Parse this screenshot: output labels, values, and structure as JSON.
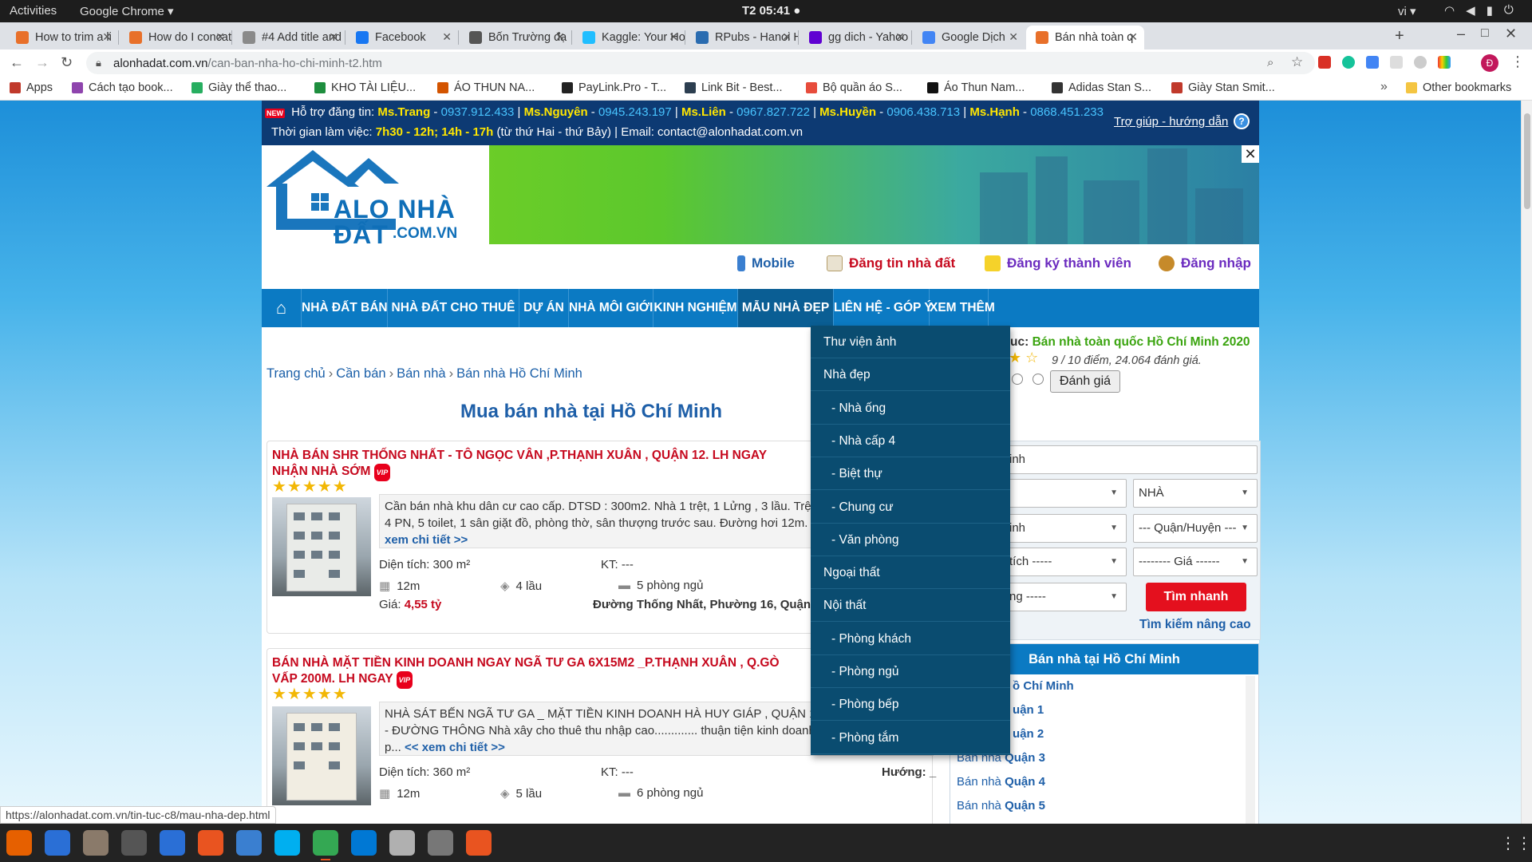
{
  "gnome": {
    "activities": "Activities",
    "app": "Google Chrome ▾",
    "clock": "T2 05:41 ●",
    "lang": "vi ▾",
    "tray": [
      "wifi-icon",
      "volume-icon",
      "battery-icon",
      "power-icon"
    ]
  },
  "tabs": [
    {
      "title": "How to trim a li",
      "icon_color": "#e8702a"
    },
    {
      "title": "How do I concat",
      "icon_color": "#e8702a"
    },
    {
      "title": "#4 Add title and",
      "icon_color": "#8a8a8a"
    },
    {
      "title": "Facebook",
      "icon_color": "#1877f2"
    },
    {
      "title": "Bốn Trường đạ",
      "icon_color": "#555555"
    },
    {
      "title": "Kaggle: Your Ho",
      "icon_color": "#20beff"
    },
    {
      "title": "RPubs - Hanoi H",
      "icon_color": "#2a6cb0"
    },
    {
      "title": "gg dich - Yahoo",
      "icon_color": "#6001d2"
    },
    {
      "title": "Google Dịch",
      "icon_color": "#4285f4"
    },
    {
      "title": "Bán nhà toàn q",
      "icon_color": "#e8702a",
      "active": true
    }
  ],
  "address": {
    "domain": "alonhadat.com.vn",
    "path": "/can-ban-nha-ho-chi-minh-t2.htm"
  },
  "bookmarks": [
    {
      "label": "Apps",
      "color": "#c0392b"
    },
    {
      "label": "Cách tạo book...",
      "color": "#8e44ad"
    },
    {
      "label": "Giày thể thao...",
      "color": "#27ae60"
    },
    {
      "label": "KHO TÀI LIỆU...",
      "color": "#1e8e3e"
    },
    {
      "label": "ÁO THUN NA...",
      "color": "#d35400"
    },
    {
      "label": "PayLink.Pro - T...",
      "color": "#222222"
    },
    {
      "label": "Link Bit - Best...",
      "color": "#2c3e50"
    },
    {
      "label": "Bộ quần áo S...",
      "color": "#e74c3c"
    },
    {
      "label": "Áo Thun Nam...",
      "color": "#111111"
    },
    {
      "label": "Adidas Stan S...",
      "color": "#333333"
    },
    {
      "label": "Giày Stan Smit...",
      "color": "#c0392b"
    }
  ],
  "bookmarks_more": "»",
  "other_bookmarks": "Other bookmarks",
  "site": {
    "new_badge": "NEW",
    "support_label": "Hỗ trợ đăng tin:",
    "contacts": [
      {
        "name": "Ms.Trang",
        "phone": "0937.912.433"
      },
      {
        "name": "Ms.Nguyên",
        "phone": "0945.243.197"
      },
      {
        "name": "Ms.Liên",
        "phone": "0967.827.722"
      },
      {
        "name": "Ms.Huyền",
        "phone": "0906.438.713"
      },
      {
        "name": "Ms.Hạnh",
        "phone": "0868.451.233"
      }
    ],
    "hours_label": "Thời gian làm việc:",
    "hours": "7h30 - 12h; 14h - 17h",
    "hours_note": "(từ thứ Hai - thứ Bảy) | Email: contact@alonhadat.com.vn",
    "help": "Trợ giúp - hướng dẫn",
    "logo_main": "ALO NHÀ ĐẤT",
    "logo_sub": ".COM.VN",
    "top_links": {
      "mobile": "Mobile",
      "post": "Đăng tin nhà đất",
      "register": "Đăng ký thành viên",
      "login": "Đăng nhập"
    },
    "nav": [
      "NHÀ ĐẤT BÁN",
      "NHÀ ĐẤT CHO THUÊ",
      "DỰ ÁN",
      "NHÀ MÔI GIỚI",
      "KINH NGHIỆM",
      "MẪU NHÀ ĐẸP",
      "LIÊN HỆ - GÓP Ý",
      "XEM THÊM"
    ],
    "breadcrumb": [
      "Trang chủ",
      "Cần bán",
      "Bán nhà",
      "Bán nhà Hồ Chí Minh"
    ],
    "page_title": "Mua bán nhà tại Hồ Chí Minh",
    "rating": {
      "label": "uc:",
      "topic": "Bán nhà toàn quốc Hồ Chí Minh 2020",
      "score": "9 / 10 điểm, 24.064 đánh giá.",
      "button": "Đánh giá"
    },
    "search": {
      "keyword": "inh",
      "type": "NHÀ",
      "city": "inh",
      "district": "--- Quận/Huyện ---",
      "area": "tích -----",
      "price": "-------- Giá ------",
      "direction": "ng -----",
      "quick": "Tìm nhanh",
      "advanced": "Tìm kiếm nâng cao"
    },
    "list": {
      "title": "Bán nhà tại Hồ Chí Minh",
      "items": [
        {
          "prefix": "",
          "name": "ồ Chí Minh"
        },
        {
          "prefix": "",
          "name": "uận 1"
        },
        {
          "prefix": "",
          "name": "uận 2"
        },
        {
          "prefix": "Bán nhà ",
          "name": "Quận 3"
        },
        {
          "prefix": "Bán nhà ",
          "name": "Quận 4"
        },
        {
          "prefix": "Bán nhà ",
          "name": "Quận 5"
        }
      ]
    },
    "listings": [
      {
        "title": "NHÀ BÁN SHR THỐNG NHẤT - TÔ NGỌC VÂN ,P.THẠNH XUÂN , QUẬN 12. LH NGAY NHẬN NHÀ SỚM",
        "vip": "VIP",
        "stars": "★★★★★",
        "desc": "Cần bán nhà khu dân cư cao cấp. DTSD : 300m2. Nhà 1 trệt, 1 Lửng , 3 lầu. Trệt 1 PK, 1 phòng bếp, 4 PN, 5 toilet, 1 sân giặt đồ, phòng thờ, sân thượng trước sau. Đường hơi 12m. Vị trí: Thống nh...",
        "more": "<< xem chi tiết >>",
        "area": "Diện tích: 300 m²",
        "kt": "KT: ---",
        "road": "12m",
        "floors": "4 lầu",
        "rooms": "5 phòng ngủ",
        "price_label": "Giá:",
        "price": "4,55 tỷ",
        "address": "Đường Thống Nhất, Phường 16, Quận"
      },
      {
        "title": "BÁN NHÀ MẶT TIỀN KINH DOANH NGAY NGÃ TƯ GA 6X15M2 _P.THẠNH XUÂN , Q.GÒ VẤP 200M. LH NGAY",
        "vip": "VIP",
        "stars": "★★★★★",
        "desc": "NHÀ SÁT BẾN NGÃ TƯ GA _ MẶT TIỀN KINH DOANH HÀ HUY GIÁP , QUẬN 12. SHR. Đường 12m - ĐƯỜNG THÔNG Nhà xây cho thuê thu nhập cao............. thuận tiện kinh doanh buôn bán, mở văn p...",
        "more": "<< xem chi tiết >>",
        "area": "Diện tích: 360 m²",
        "kt": "KT: ---",
        "direction": "Hướng: _",
        "road": "12m",
        "floors": "5 lầu",
        "rooms": "6 phòng ngủ"
      }
    ],
    "dropdown": [
      {
        "label": "Thư viện ảnh",
        "sub": false
      },
      {
        "label": "Nhà đẹp",
        "sub": false
      },
      {
        "label": "- Nhà ống",
        "sub": true
      },
      {
        "label": "- Nhà cấp 4",
        "sub": true
      },
      {
        "label": "- Biệt thự",
        "sub": true
      },
      {
        "label": "- Chung cư",
        "sub": true
      },
      {
        "label": "- Văn phòng",
        "sub": true
      },
      {
        "label": "Ngoại thất",
        "sub": false
      },
      {
        "label": "Nội thất",
        "sub": false
      },
      {
        "label": "- Phòng khách",
        "sub": true
      },
      {
        "label": "- Phòng ngủ",
        "sub": true
      },
      {
        "label": "- Phòng bếp",
        "sub": true
      },
      {
        "label": "- Phòng tắm",
        "sub": true
      }
    ]
  },
  "status_url": "https://alonhadat.com.vn/tin-tuc-c8/mau-nha-dep.html",
  "taskbar": [
    {
      "name": "firefox-icon",
      "color": "#e66000"
    },
    {
      "name": "thunderbird-icon",
      "color": "#2a6fd6"
    },
    {
      "name": "files-icon",
      "color": "#8a7a6a"
    },
    {
      "name": "terminal-icon",
      "color": "#555555"
    },
    {
      "name": "libreoffice-writer-icon",
      "color": "#2a6fd6"
    },
    {
      "name": "software-center-icon",
      "color": "#e95420"
    },
    {
      "name": "help-icon",
      "color": "#3a7fd0"
    },
    {
      "name": "skype-icon",
      "color": "#00aff0"
    },
    {
      "name": "chrome-icon",
      "color": "#34a853",
      "active": true
    },
    {
      "name": "vscode-icon",
      "color": "#0078d4"
    },
    {
      "name": "settings-icon",
      "color": "#b0b0b0"
    },
    {
      "name": "screenshot-icon",
      "color": "#777777"
    },
    {
      "name": "impress-icon",
      "color": "#e95420"
    }
  ]
}
